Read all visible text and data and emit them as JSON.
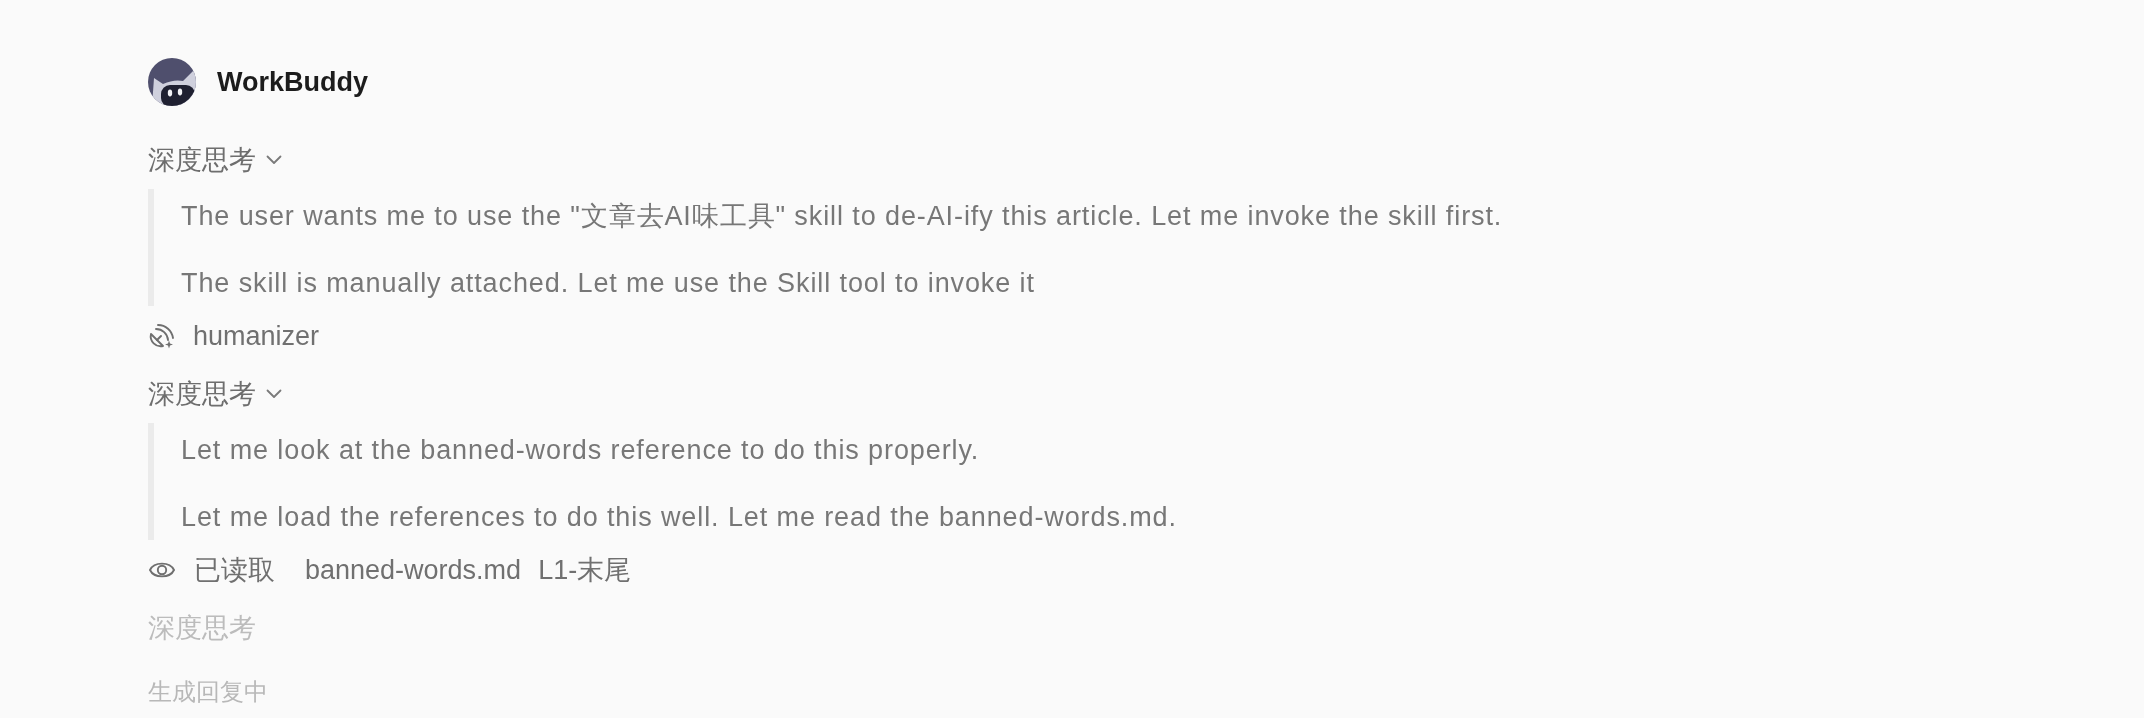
{
  "header": {
    "title": "WorkBuddy"
  },
  "steps": [
    {
      "kind": "thinking",
      "label": "深度思考",
      "expanded": true,
      "paragraphs": [
        "The user wants me to use the \"文章去AI味工具\" skill to de-AI-ify this article. Let me invoke the skill first.",
        "The skill is manually attached. Let me use the Skill tool to invoke it"
      ]
    },
    {
      "kind": "skill",
      "name": "humanizer"
    },
    {
      "kind": "thinking",
      "label": "深度思考",
      "expanded": true,
      "paragraphs": [
        "Let me look at the banned-words reference to do this properly.",
        "Let me load the references to do this well. Let me read the banned-words.md."
      ]
    },
    {
      "kind": "read",
      "action": "已读取",
      "file": "banned-words.md",
      "range": "L1-末尾"
    },
    {
      "kind": "thinking-live",
      "label": "深度思考"
    }
  ],
  "status": "生成回复中"
}
